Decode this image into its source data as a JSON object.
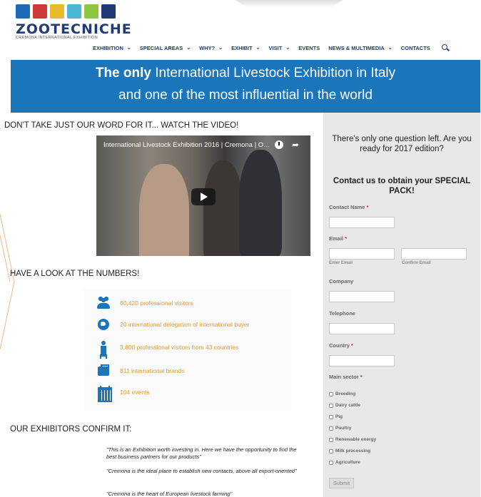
{
  "logo": {
    "tile_colors": [
      "#1f6bb5",
      "#d13a3a",
      "#e8b92a",
      "#4cb6d8",
      "#8cc63f",
      "#1f3a75"
    ],
    "name": "ZOOTECNICHE",
    "subtitle": "CREMONA INTERNATIONAL EXHIBITION"
  },
  "nav": {
    "items": [
      {
        "label": "EXHIBITION",
        "dropdown": true
      },
      {
        "label": "SPECIAL AREAS",
        "dropdown": true
      },
      {
        "label": "WHY?",
        "dropdown": true
      },
      {
        "label": "EXHIBIT",
        "dropdown": true
      },
      {
        "label": "VISIT",
        "dropdown": true
      },
      {
        "label": "EVENTS",
        "dropdown": false
      },
      {
        "label": "NEWS & MULTIMEDIA",
        "dropdown": true
      },
      {
        "label": "CONTACTS",
        "dropdown": false
      }
    ],
    "search_icon": "search-icon"
  },
  "hero": {
    "line1_bold": "The only",
    "line1_rest": " International Livestock Exhibition in Italy",
    "line2": "and one of the most influential in the world",
    "background": "#1b75bb"
  },
  "video_section": {
    "heading": "DON'T TAKE JUST OUR WORD FOR IT... WATCH THE VIDEO!",
    "video_title": "International Livestock Exhibition 2016 | Cremona | O..."
  },
  "numbers": {
    "heading": "HAVE A LOOK AT THE NUMBERS!",
    "stats": [
      {
        "icon": "people-icon",
        "label": "60,420 professional visitors"
      },
      {
        "icon": "globe-icon",
        "label": "20 international delegation of international buyer"
      },
      {
        "icon": "person-icon",
        "label": "3,800 professional visitors from 43 countries"
      },
      {
        "icon": "briefcase-icon",
        "label": "811 international brands"
      },
      {
        "icon": "calendar-icon",
        "label": "104 events"
      }
    ],
    "accent": "#e29a2b"
  },
  "exhibitors": {
    "heading": "OUR EXHIBITORS CONFIRM IT:",
    "quotes": [
      "\"This is an Exhibition worth investing in. Here we have the opportunity to find the best business partners for our products\"",
      "\"Cremona is the ideal place to establish new contacts, above all export-oriented\"",
      "\"Cremona is the heart of European livestock farming\""
    ]
  },
  "form": {
    "question": "There's only one question left. Are you ready for 2017 edition?",
    "heading": "Contact us to obtain your SPECIAL PACK!",
    "contact_name_label": "Contact Name",
    "email_label": "Email",
    "enter_email": "Enter Email",
    "confirm_email": "Confirm Email",
    "company_label": "Company",
    "telephone_label": "Telephone",
    "country_label": "Country",
    "sector_label": "Main sector",
    "required_mark": "*",
    "sectors": [
      "Breeding",
      "Dairy cattle",
      "Pig",
      "Poultry",
      "Renewable energy",
      "Milk processing",
      "Agriculture"
    ],
    "submit_label": "Submit"
  }
}
